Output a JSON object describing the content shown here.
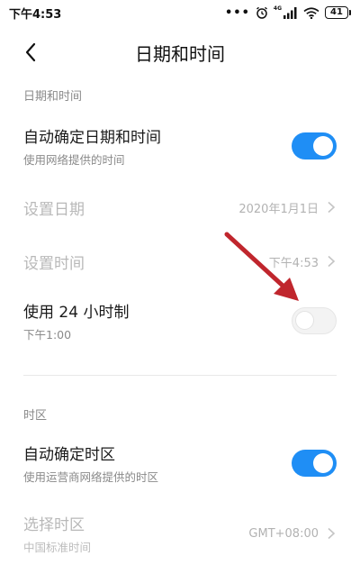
{
  "status_bar": {
    "time": "下午4:53",
    "dots": "•••",
    "network_badge": "4G",
    "battery": "41"
  },
  "header": {
    "title": "日期和时间"
  },
  "sections": {
    "datetime_label": "日期和时间",
    "timezone_label": "时区"
  },
  "settings": {
    "auto_datetime": {
      "title": "自动确定日期和时间",
      "subtitle": "使用网络提供的时间",
      "enabled": true
    },
    "set_date": {
      "title": "设置日期",
      "value": "2020年1月1日"
    },
    "set_time": {
      "title": "设置时间",
      "value": "下午4:53"
    },
    "use_24h": {
      "title": "使用 24 小时制",
      "subtitle": "下午1:00",
      "enabled": false
    },
    "auto_timezone": {
      "title": "自动确定时区",
      "subtitle": "使用运营商网络提供的时区",
      "enabled": true
    },
    "select_timezone": {
      "title": "选择时区",
      "subtitle": "中国标准时间",
      "value": "GMT+08:00"
    }
  },
  "colors": {
    "accent": "#1f8ef5",
    "annotation_arrow": "#c0262d"
  }
}
